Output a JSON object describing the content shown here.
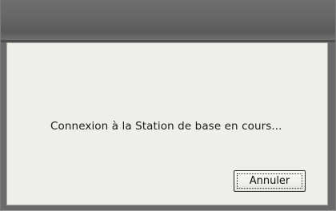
{
  "dialog": {
    "title": "",
    "message": "Connexion à la Station de base en cours...",
    "cancel_label": "Annuler"
  }
}
